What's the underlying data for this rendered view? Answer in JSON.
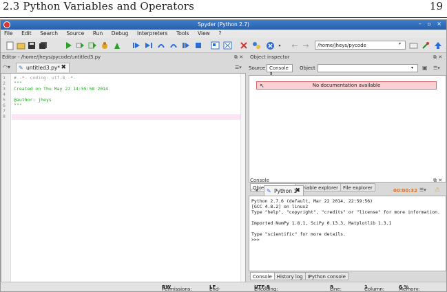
{
  "page": {
    "section": "2.3 Python Variables and Operators",
    "page_number": "19"
  },
  "window": {
    "title": "Spyder (Python 2.7)",
    "controls": "– ▫ ×"
  },
  "menu": [
    "File",
    "Edit",
    "Search",
    "Source",
    "Run",
    "Debug",
    "Interpreters",
    "Tools",
    "View",
    "?"
  ],
  "toolbar": {
    "path": "/home/jheys/pycode"
  },
  "editor": {
    "header": "Editor - /home/jheys/pycode/untitled3.py",
    "tab_label": "untitled3.py*",
    "line_numbers": [
      "1",
      "2",
      "3",
      "4",
      "5",
      "6",
      "7",
      "8"
    ],
    "lines": [
      {
        "text": "# -*- coding: utf-8 -*-",
        "color": "gray"
      },
      {
        "text": "\"\"\"",
        "color": "green"
      },
      {
        "text": "Created on Thu May 22 14:55:58 2014",
        "color": "green"
      },
      {
        "text": "",
        "color": "green"
      },
      {
        "text": "@author: jheys",
        "color": "green"
      },
      {
        "text": "\"\"\"",
        "color": "green"
      },
      {
        "text": "",
        "color": "gray"
      },
      {
        "text": "",
        "color": "gray"
      }
    ]
  },
  "object_inspector": {
    "header": "Object inspector",
    "source_label": "Source",
    "source_value": "Console",
    "object_label": "Object",
    "object_value": "",
    "message": "No documentation available",
    "tabs": [
      "Object inspector",
      "Variable explorer",
      "File explorer"
    ]
  },
  "console": {
    "header": "Console",
    "tab_label": "Python 1",
    "timer": "00:00:32",
    "lines": [
      "Python 2.7.6 (default, Mar 22 2014, 22:59:56)",
      "[GCC 4.8.2] on linux2",
      "Type \"help\", \"copyright\", \"credits\" or \"license\" for more information.",
      "",
      "Imported NumPy 1.8.1, SciPy 0.13.3, Matplotlib 1.3.1",
      "",
      "Type \"scientific\" for more details.",
      ">>>"
    ],
    "tabs": [
      "Console",
      "History log",
      "IPython console"
    ]
  },
  "status": {
    "permissions_label": "Permissions:",
    "permissions_value": "RW",
    "eol_label": "End-of-lines:",
    "eol_value": "LF",
    "encoding_label": "Encoding:",
    "encoding_value": "UTF-8",
    "line_label": "Line:",
    "line_value": "8",
    "column_label": "Column:",
    "column_value": "1",
    "memory_label": "Memory:",
    "memory_value": "6 %"
  },
  "colors": {
    "accent_title": "#2b5ea8",
    "nodoc_bg": "#fbd0d4",
    "code_green": "#2a9d2a",
    "timer_orange": "#d9732b"
  }
}
